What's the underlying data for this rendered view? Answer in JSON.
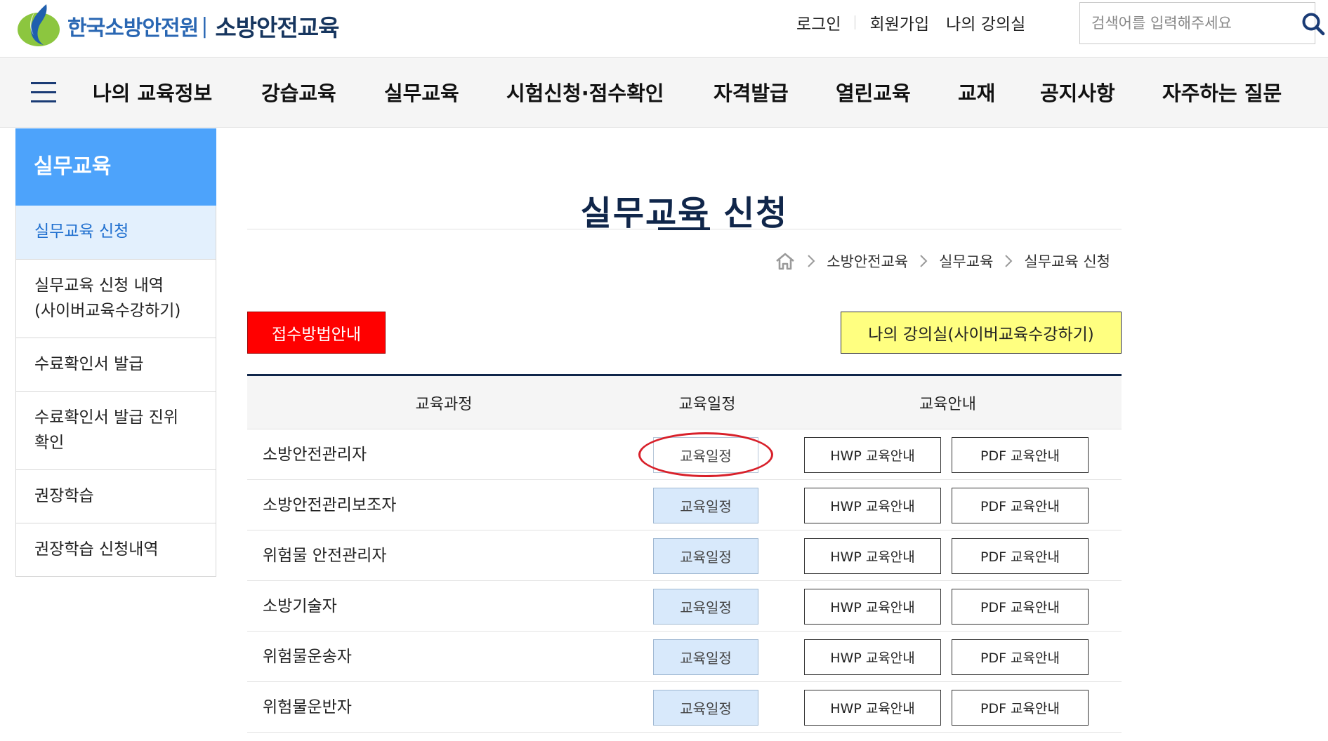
{
  "header": {
    "org_name": "한국소방안전원",
    "separator": "|",
    "site_name": "소방안전교육",
    "util_links": [
      "로그인",
      "회원가입",
      "나의 강의실"
    ],
    "search_placeholder": "검색어를 입력해주세요"
  },
  "gnb": {
    "items": [
      "나의 교육정보",
      "강습교육",
      "실무교육",
      "시험신청·점수확인",
      "자격발급",
      "열린교육",
      "교재",
      "공지사항",
      "자주하는 질문"
    ]
  },
  "sidebar": {
    "title": "실무교육",
    "items": [
      {
        "label": "실무교육 신청",
        "active": true
      },
      {
        "label": "실무교육 신청 내역\n(사이버교육수강하기)",
        "active": false
      },
      {
        "label": "수료확인서 발급",
        "active": false
      },
      {
        "label": "수료확인서 발급 진위\n확인",
        "active": false
      },
      {
        "label": "권장학습",
        "active": false
      },
      {
        "label": "권장학습 신청내역",
        "active": false
      }
    ]
  },
  "main": {
    "title": "실무교육 신청",
    "breadcrumb": [
      "소방안전교육",
      "실무교육",
      "실무교육 신청"
    ],
    "guide_button": "접수방법안내",
    "myclass_button": "나의 강의실(사이버교육수강하기)",
    "table": {
      "headers": [
        "교육과정",
        "교육일정",
        "교육안내"
      ],
      "rows": [
        {
          "course": "소방안전관리자",
          "schedule": "교육일정",
          "hwp": "HWP 교육안내",
          "pdf": "PDF 교육안내"
        },
        {
          "course": "소방안전관리보조자",
          "schedule": "교육일정",
          "hwp": "HWP 교육안내",
          "pdf": "PDF 교육안내"
        },
        {
          "course": "위험물 안전관리자",
          "schedule": "교육일정",
          "hwp": "HWP 교육안내",
          "pdf": "PDF 교육안내"
        },
        {
          "course": "소방기술자",
          "schedule": "교육일정",
          "hwp": "HWP 교육안내",
          "pdf": "PDF 교육안내"
        },
        {
          "course": "위험물운송자",
          "schedule": "교육일정",
          "hwp": "HWP 교육안내",
          "pdf": "PDF 교육안내"
        },
        {
          "course": "위험물운반자",
          "schedule": "교육일정",
          "hwp": "HWP 교육안내",
          "pdf": "PDF 교육안내"
        }
      ]
    }
  },
  "colors": {
    "brand_navy": "#10264a",
    "brand_blue": "#2a67b3",
    "sidebar_head": "#4da3fb",
    "sidebar_active_bg": "#e3f0fd",
    "guide_button_bg": "#ff0000",
    "myclass_button_bg": "#ffff80",
    "schedule_button_bg": "#d8e9fb",
    "highlight_ring": "#d8202a"
  },
  "icons": {
    "logo": "flame-leaf-logo",
    "search": "search-icon",
    "menu": "hamburger-menu-icon",
    "home": "home-icon",
    "breadcrumb_separator": "chevron-right-icon"
  }
}
